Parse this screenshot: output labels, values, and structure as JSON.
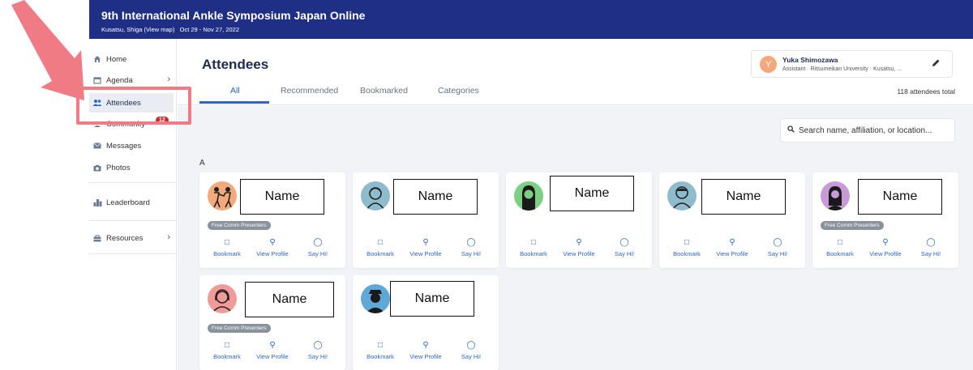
{
  "header": {
    "title": "9th International Ankle Symposium Japan Online",
    "location": "Kusatsu, Shiga",
    "view_map": "(View map)",
    "dates": "Oct 29 - Nov 27, 2022"
  },
  "sidebar": {
    "items": [
      {
        "label": "Home",
        "icon": "home-icon"
      },
      {
        "label": "Agenda",
        "icon": "calendar-icon"
      },
      {
        "label": "Attendees",
        "icon": "people-icon"
      },
      {
        "label": "Community",
        "icon": "community-icon",
        "badge": "12"
      },
      {
        "label": "Messages",
        "icon": "envelope-icon"
      },
      {
        "label": "Photos",
        "icon": "camera-icon"
      },
      {
        "label": "Leaderboard",
        "icon": "leaderboard-icon"
      },
      {
        "label": "Resources",
        "icon": "briefcase-icon"
      }
    ]
  },
  "main": {
    "title": "Attendees",
    "tabs": [
      {
        "label": "All"
      },
      {
        "label": "Recommended"
      },
      {
        "label": "Bookmarked"
      },
      {
        "label": "Categories"
      }
    ],
    "total": "118 attendees total",
    "search_placeholder": "Search name, affiliation, or location...",
    "section_letter": "A"
  },
  "user": {
    "initial": "Y",
    "name": "Yuka Shimozawa",
    "role": "Assistant · Ritsumeikan University · Kusatsu, ..."
  },
  "card_actions": {
    "bookmark": "Bookmark",
    "view_profile": "View Profile",
    "say_hi": "Say Hi!"
  },
  "attendees": [
    {
      "name": "Name",
      "tag": "Free Comm Presenters",
      "avatar_color": "#f4a97c"
    },
    {
      "name": "Name",
      "tag": "",
      "avatar_color": "#8fbccd"
    },
    {
      "name": "Name",
      "tag": "",
      "avatar_color": "#7ccf84"
    },
    {
      "name": "Name",
      "tag": "",
      "avatar_color": "#8fbccd"
    },
    {
      "name": "Name",
      "tag": "Free Comm Presenters",
      "avatar_color": "#c99ad8"
    },
    {
      "name": "Name",
      "tag": "Free Comm Presenters",
      "avatar_color": "#f09a9a"
    },
    {
      "name": "Name",
      "tag": "",
      "avatar_color": "#5fa8d8"
    }
  ],
  "colors": {
    "header_bg": "#1f2f86",
    "accent": "#2b66c4",
    "highlight": "#f07b85",
    "badge": "#cc2b2b"
  }
}
